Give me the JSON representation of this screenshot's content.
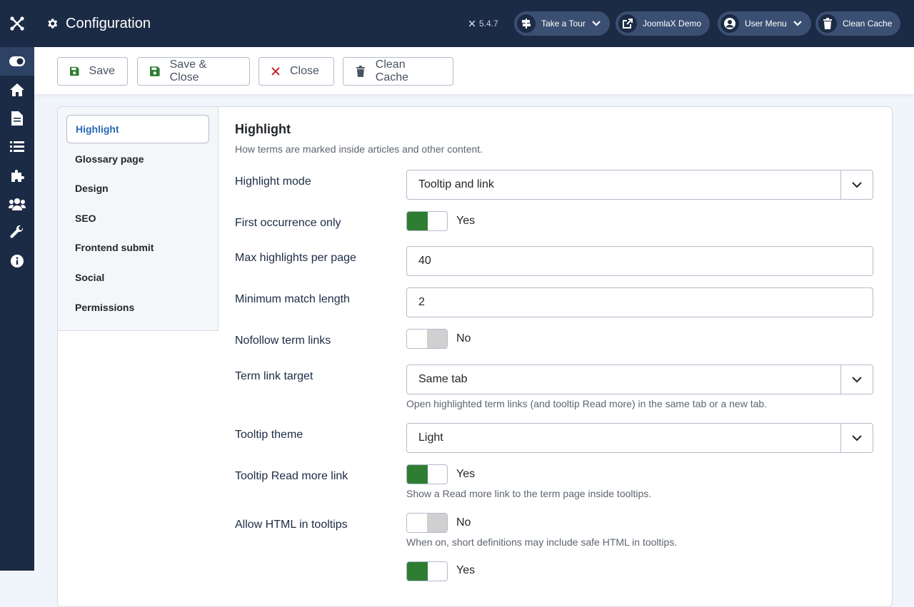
{
  "header": {
    "title": "Configuration",
    "version": "5.4.7",
    "buttons": [
      {
        "label": "Take a Tour",
        "icon": "signpost-icon"
      },
      {
        "label": "JoomlaX Demo",
        "icon": "external-link-icon"
      },
      {
        "label": "User Menu",
        "icon": "user-circle-icon"
      },
      {
        "label": "Clean Cache",
        "icon": "trash-icon"
      }
    ]
  },
  "sidebar": {
    "items": [
      {
        "icon": "toggle-icon"
      },
      {
        "icon": "home-icon"
      },
      {
        "icon": "file-icon"
      },
      {
        "icon": "list-icon"
      },
      {
        "icon": "puzzle-icon"
      },
      {
        "icon": "users-icon"
      },
      {
        "icon": "wrench-icon"
      },
      {
        "icon": "info-icon"
      }
    ]
  },
  "toolbar": {
    "save": "Save",
    "save_close": "Save & Close",
    "close": "Close",
    "clean_cache": "Clean Cache"
  },
  "tabs": [
    "Highlight",
    "Glossary page",
    "Design",
    "SEO",
    "Frontend submit",
    "Social",
    "Permissions"
  ],
  "section": {
    "title": "Highlight",
    "description": "How terms are marked inside articles and other content."
  },
  "fields": {
    "highlight_mode": {
      "label": "Highlight mode",
      "value": "Tooltip and link"
    },
    "first_occurrence": {
      "label": "First occurrence only",
      "value": "Yes"
    },
    "max_highlights": {
      "label": "Max highlights per page",
      "value": "40"
    },
    "min_match": {
      "label": "Minimum match length",
      "value": "2"
    },
    "nofollow": {
      "label": "Nofollow term links",
      "value": "No"
    },
    "link_target": {
      "label": "Term link target",
      "value": "Same tab",
      "help": "Open highlighted term links (and tooltip Read more) in the same tab or a new tab."
    },
    "tooltip_theme": {
      "label": "Tooltip theme",
      "value": "Light"
    },
    "read_more": {
      "label": "Tooltip Read more link",
      "value": "Yes",
      "help": "Show a Read more link to the term page inside tooltips."
    },
    "allow_html": {
      "label": "Allow HTML in tooltips",
      "value": "No",
      "help": "When on, short definitions may include safe HTML in tooltips."
    },
    "next_toggle": {
      "value": "Yes"
    }
  },
  "colors": {
    "header_bg": "#1c2b45",
    "toggle_on": "#2f7d32",
    "active_tab": "#2a69b8"
  }
}
